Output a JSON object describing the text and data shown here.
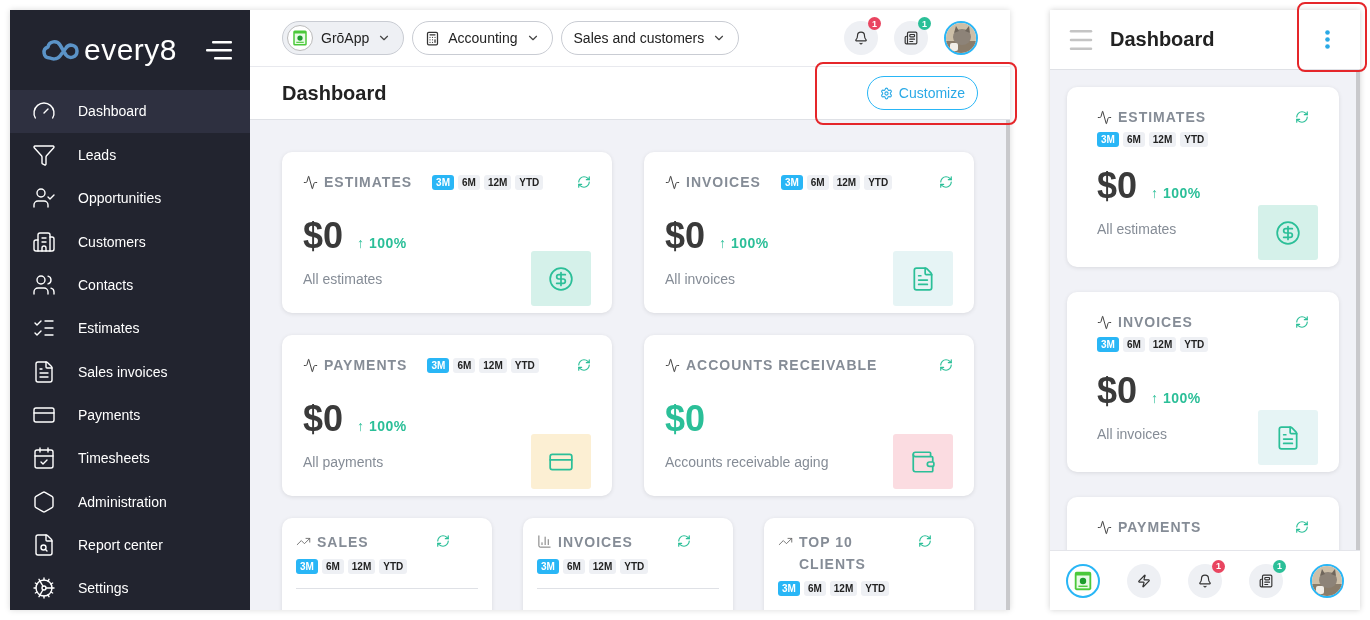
{
  "sidebar": {
    "logo": "every8",
    "items": [
      {
        "label": "Dashboard",
        "selected": true
      },
      {
        "label": "Leads",
        "selected": false
      },
      {
        "label": "Opportunities",
        "selected": false
      },
      {
        "label": "Customers",
        "selected": false
      },
      {
        "label": "Contacts",
        "selected": false
      },
      {
        "label": "Estimates",
        "selected": false
      },
      {
        "label": "Sales invoices",
        "selected": false
      },
      {
        "label": "Payments",
        "selected": false
      },
      {
        "label": "Timesheets",
        "selected": false
      },
      {
        "label": "Administration",
        "selected": false
      },
      {
        "label": "Report center",
        "selected": false
      },
      {
        "label": "Settings",
        "selected": false
      }
    ]
  },
  "topbar": {
    "apps": [
      {
        "label": "GrōApp"
      },
      {
        "label": "Accounting"
      },
      {
        "label": "Sales and customers"
      }
    ],
    "notifications": "1",
    "news": "1"
  },
  "page": {
    "title": "Dashboard",
    "customize": {
      "label": "Customize",
      "highlighted": true
    }
  },
  "stat_cards": [
    {
      "title": "ESTIMATES",
      "periods": [
        {
          "label": "3M",
          "selected": true
        },
        {
          "label": "6M",
          "selected": false
        },
        {
          "label": "12M",
          "selected": false
        },
        {
          "label": "YTD",
          "selected": false
        }
      ],
      "value": "$0",
      "value_accent": false,
      "change": "↑ 100%",
      "caption": "All estimates",
      "color": "#d5f1ea"
    },
    {
      "title": "INVOICES",
      "periods": [
        {
          "label": "3M",
          "selected": true
        },
        {
          "label": "6M",
          "selected": false
        },
        {
          "label": "12M",
          "selected": false
        },
        {
          "label": "YTD",
          "selected": false
        }
      ],
      "value": "$0",
      "value_accent": false,
      "change": "↑ 100%",
      "caption": "All invoices",
      "color": "#e6f4f5"
    },
    {
      "title": "PAYMENTS",
      "periods": [
        {
          "label": "3M",
          "selected": true
        },
        {
          "label": "6M",
          "selected": false
        },
        {
          "label": "12M",
          "selected": false
        },
        {
          "label": "YTD",
          "selected": false
        }
      ],
      "value": "$0",
      "value_accent": false,
      "change": "↑ 100%",
      "caption": "All payments",
      "color": "#fcefd3"
    },
    {
      "title": "ACCOUNTS RECEIVABLE",
      "value": "$0",
      "value_accent": true,
      "caption": "Accounts receivable aging",
      "color": "#fbdce1"
    }
  ],
  "chart_cards": [
    {
      "title": "SALES",
      "periods": [
        {
          "label": "3M",
          "selected": true
        },
        {
          "label": "6M",
          "selected": false
        },
        {
          "label": "12M",
          "selected": false
        },
        {
          "label": "YTD",
          "selected": false
        }
      ]
    },
    {
      "title": "INVOICES",
      "periods": [
        {
          "label": "3M",
          "selected": true
        },
        {
          "label": "6M",
          "selected": false
        },
        {
          "label": "12M",
          "selected": false
        },
        {
          "label": "YTD",
          "selected": false
        }
      ]
    },
    {
      "title": "TOP 10 CLIENTS",
      "periods": [
        {
          "label": "3M",
          "selected": true
        },
        {
          "label": "6M",
          "selected": false
        },
        {
          "label": "12M",
          "selected": false
        },
        {
          "label": "YTD",
          "selected": false
        }
      ]
    }
  ],
  "mobile": {
    "title": "Dashboard",
    "menu_highlighted": true,
    "cards": [
      {
        "title": "ESTIMATES",
        "periods": [
          {
            "label": "3M",
            "selected": true
          },
          {
            "label": "6M",
            "selected": false
          },
          {
            "label": "12M",
            "selected": false
          },
          {
            "label": "YTD",
            "selected": false
          }
        ],
        "value": "$0",
        "change": "↑ 100%",
        "caption": "All estimates",
        "color": "#d5f1ea"
      },
      {
        "title": "INVOICES",
        "periods": [
          {
            "label": "3M",
            "selected": true
          },
          {
            "label": "6M",
            "selected": false
          },
          {
            "label": "12M",
            "selected": false
          },
          {
            "label": "YTD",
            "selected": false
          }
        ],
        "value": "$0",
        "change": "↑ 100%",
        "caption": "All invoices",
        "color": "#e6f4f5"
      },
      {
        "title": "PAYMENTS"
      }
    ],
    "notifications": "1",
    "news": "1"
  }
}
